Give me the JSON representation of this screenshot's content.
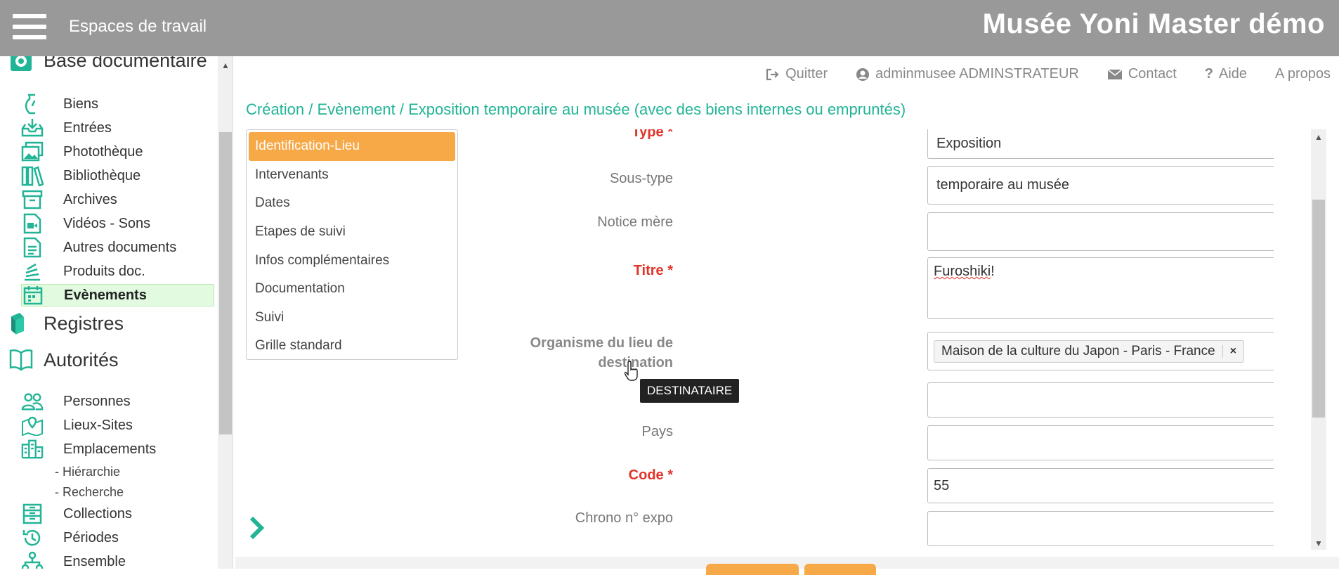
{
  "topbar": {
    "workspaces_label": "Espaces de travail",
    "app_title": "Musée Yoni Master démo"
  },
  "sidebar": {
    "sections": [
      {
        "label": "Base documentaire",
        "icon": "database-icon"
      },
      {
        "label": "Registres",
        "icon": "books-icon"
      },
      {
        "label": "Autorités",
        "icon": "open-book-icon"
      }
    ],
    "items": [
      {
        "label": "Biens",
        "icon": "vase-icon"
      },
      {
        "label": "Entrées",
        "icon": "inbox-download-icon"
      },
      {
        "label": "Photothèque",
        "icon": "images-icon"
      },
      {
        "label": "Bibliothèque",
        "icon": "library-icon"
      },
      {
        "label": "Archives",
        "icon": "archive-box-icon"
      },
      {
        "label": "Vidéos - Sons",
        "icon": "video-file-icon"
      },
      {
        "label": "Autres documents",
        "icon": "document-icon"
      },
      {
        "label": "Produits doc.",
        "icon": "stack-icon"
      },
      {
        "label": "Evènements",
        "icon": "calendar-icon",
        "active": true
      },
      {
        "label": "Personnes",
        "icon": "people-icon"
      },
      {
        "label": "Lieux-Sites",
        "icon": "map-pin-icon"
      },
      {
        "label": "Emplacements",
        "icon": "building-icon"
      },
      {
        "label": "- Hiérarchie"
      },
      {
        "label": "- Recherche"
      },
      {
        "label": "Collections",
        "icon": "cabinet-icon"
      },
      {
        "label": "Périodes",
        "icon": "history-icon"
      },
      {
        "label": "Ensemble",
        "icon": "network-icon"
      }
    ]
  },
  "toplinks": {
    "quit": "Quitter",
    "user": "adminmusee ADMINSTRATEUR",
    "contact": "Contact",
    "help": "Aide",
    "about": "A propos"
  },
  "breadcrumb": "Création / Evènement / Exposition temporaire au musée (avec des biens internes ou empruntés)",
  "tabs": [
    "Identification-Lieu",
    "Intervenants",
    "Dates",
    "Etapes de suivi",
    "Infos complémentaires",
    "Documentation",
    "Suivi",
    "Grille standard"
  ],
  "form": {
    "type_label": "Type *",
    "type_value": "Exposition",
    "subtype_label": "Sous-type",
    "subtype_value": "temporaire au musée",
    "parent_label": "Notice mère",
    "title_label": "Titre *",
    "title_value_word": "Furoshiki",
    "title_value_rest": " !",
    "org_label_1": "Organisme du lieu de",
    "org_label_2": "destination",
    "org_chip": "Maison de la culture du Japon - Paris - France",
    "org_chip_remove": "×",
    "country_label": "Pays",
    "code_label": "Code *",
    "code_value": "55",
    "chrono_label": "Chrono n° expo"
  },
  "tooltip": "DESTINATAIRE",
  "colors": {
    "accent": "#22b496",
    "active_tab": "#f7a847",
    "required": "#e0342a",
    "topbar": "#999999"
  }
}
